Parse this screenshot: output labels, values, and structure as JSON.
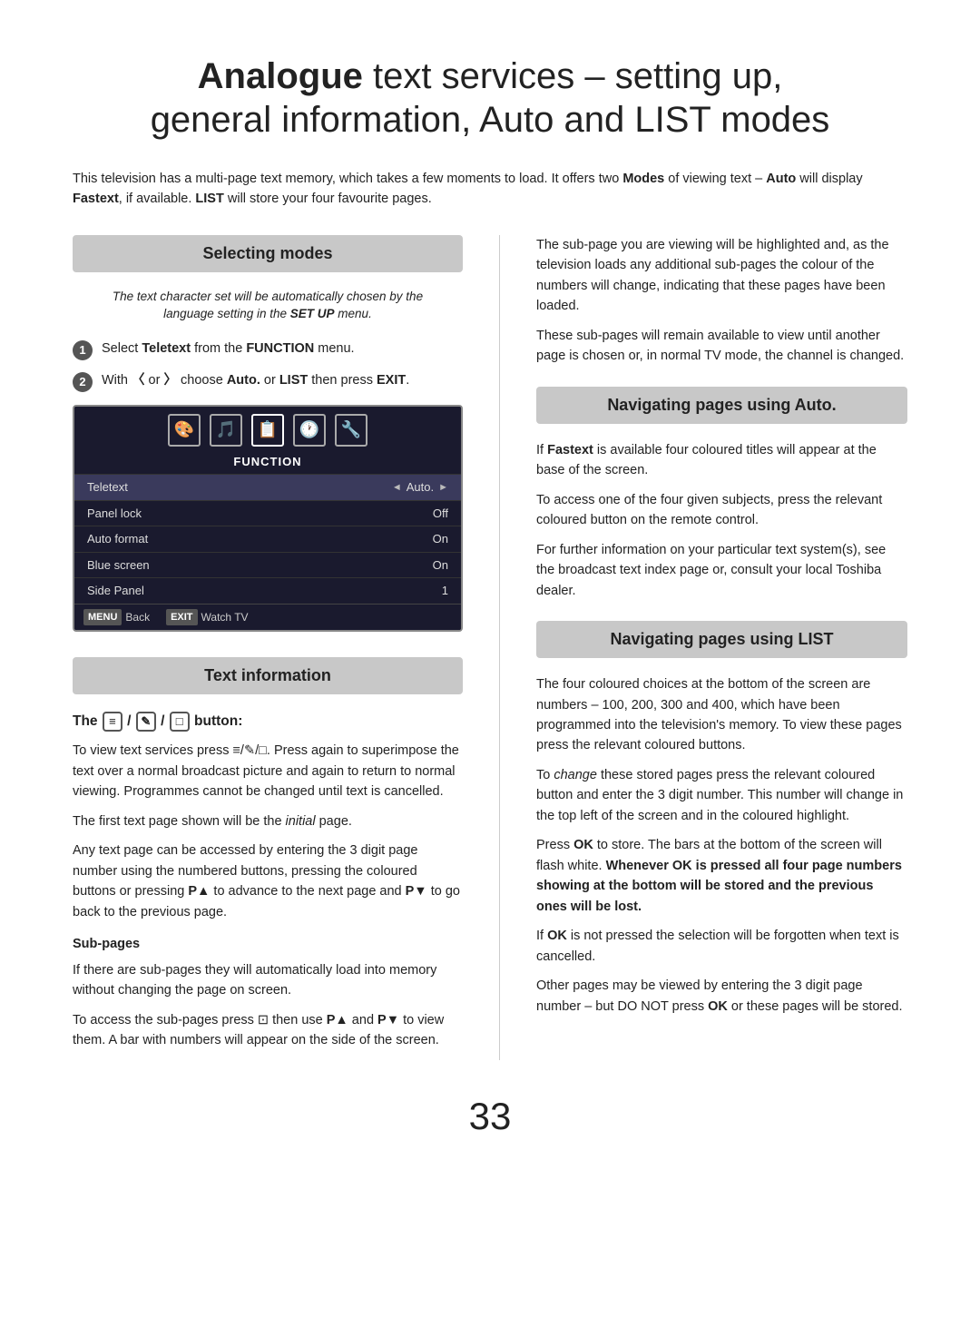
{
  "page": {
    "title_normal": " text services – setting up,",
    "title_bold": "Analogue",
    "title_line2": "general information, Auto and LIST modes",
    "intro": "This television has a multi-page text memory, which takes a few moments to load. It offers two Modes of viewing text – Auto will display Fastext, if available. LIST will store your four favourite pages.",
    "page_number": "33"
  },
  "selecting_modes": {
    "header": "Selecting modes",
    "italic_note": "The text character set will be automatically chosen by the language setting in the SET UP menu.",
    "step1": "Select Teletext from the FUNCTION menu.",
    "step2": "With  or  choose Auto. or LIST then press EXIT.",
    "tv_screen": {
      "icons": [
        "🎨",
        "🎵",
        "📋",
        "🕐",
        "🔧"
      ],
      "label": "FUNCTION",
      "rows": [
        {
          "label": "Teletext",
          "value": "Auto.",
          "arrow_left": true,
          "arrow_right": true,
          "highlighted": true
        },
        {
          "label": "Panel lock",
          "value": "Off",
          "highlighted": false
        },
        {
          "label": "Auto format",
          "value": "On",
          "highlighted": false
        },
        {
          "label": "Blue screen",
          "value": "On",
          "highlighted": false
        },
        {
          "label": "Side Panel",
          "value": "1",
          "highlighted": false
        }
      ],
      "footer": [
        {
          "btn": "MENU",
          "label": "Back"
        },
        {
          "btn": "EXIT",
          "label": "Watch TV"
        }
      ]
    }
  },
  "text_information": {
    "header": "Text information",
    "button_label": "The  /  /  button:",
    "para1": "To view text services press ≡/✎/□. Press again to superimpose the text over a normal broadcast picture and again to return to normal viewing. Programmes cannot be changed until text is cancelled.",
    "para2": "The first text page shown will be the initial page.",
    "para3": "Any text page can be accessed by entering the 3 digit page number using the numbered buttons, pressing the coloured buttons or pressing P▲ to advance to the next page and P▼ to go back to the previous page.",
    "subpages_title": "Sub-pages",
    "subpages_para1": "If there are sub-pages they will automatically load into memory without changing the page on screen.",
    "subpages_para2": "To access the sub-pages press ⊡ then use P▲ and P▼ to view them. A bar with numbers will appear on the side of the screen."
  },
  "right_column": {
    "right_top_para1": "The sub-page you are viewing will be highlighted and, as the television loads any additional sub-pages the colour of the numbers will change, indicating that these pages have been loaded.",
    "right_top_para2": "These sub-pages will remain available to view until another page is chosen or, in normal TV mode, the channel is changed.",
    "nav_auto_header": "Navigating pages using Auto.",
    "nav_auto_para1": "If Fastext is available four coloured titles will appear at the base of the screen.",
    "nav_auto_para2": "To access one of the four given subjects, press the relevant coloured button on the remote control.",
    "nav_auto_para3": "For further information on your particular text system(s), see the broadcast text index page or, consult your local Toshiba dealer.",
    "nav_list_header": "Navigating pages using LIST",
    "nav_list_para1": "The four coloured choices at the bottom of the screen are numbers – 100, 200, 300 and 400, which have been programmed into the television's memory. To view these pages press the relevant coloured buttons.",
    "nav_list_para2": "To change these stored pages press the relevant coloured button and enter the 3 digit number. This number will change in the top left of the screen and in the coloured highlight.",
    "nav_list_para3": "Press OK to store. The bars at the bottom of the screen will flash white. Whenever OK is pressed all four page numbers showing at the bottom will be stored and the previous ones will be lost.",
    "nav_list_para4": "If OK is not pressed the selection will be forgotten when text is cancelled.",
    "nav_list_para5": "Other pages may be viewed by entering the 3 digit page number – but DO NOT press OK or these pages will be stored."
  }
}
